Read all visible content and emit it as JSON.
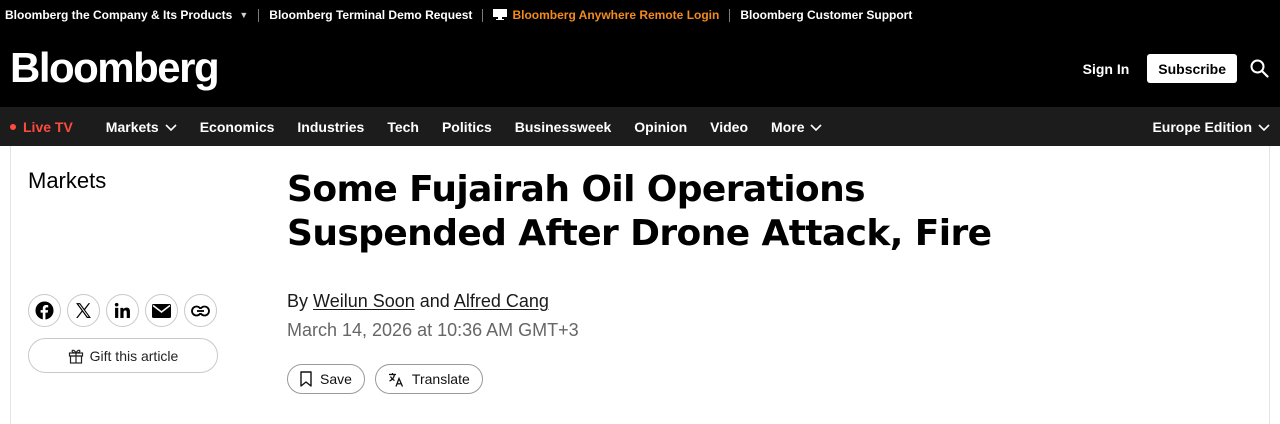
{
  "utility_bar": {
    "items": [
      {
        "label": "Bloomberg the Company & Its Products"
      },
      {
        "label": "Bloomberg Terminal Demo Request"
      },
      {
        "label": "Bloomberg Anywhere Remote Login"
      },
      {
        "label": "Bloomberg Customer Support"
      }
    ],
    "accent_color": "#f48a1e"
  },
  "masthead": {
    "logo": "Bloomberg",
    "sign_in": "Sign In",
    "subscribe": "Subscribe",
    "search_icon": "search-icon"
  },
  "nav": {
    "live_tv": "Live TV",
    "live_color": "#ff4b3e",
    "items": [
      {
        "label": "Markets"
      },
      {
        "label": "Economics"
      },
      {
        "label": "Industries"
      },
      {
        "label": "Tech"
      },
      {
        "label": "Politics"
      },
      {
        "label": "Businessweek"
      },
      {
        "label": "Opinion"
      },
      {
        "label": "Video"
      },
      {
        "label": "More"
      }
    ],
    "edition": "Europe Edition"
  },
  "article": {
    "section": "Markets",
    "headline_line1": "Some Fujairah Oil Operations",
    "headline_line2": "Suspended After Drone Attack, Fire",
    "byline_prefix": "By",
    "author1": "Weilun Soon",
    "byline_and": "and",
    "author2": "Alfred Cang",
    "date": "March 14, 2026 at 10:36 AM GMT+3",
    "share_icons": [
      "facebook-icon",
      "x-icon",
      "linkedin-icon",
      "email-icon",
      "link-icon"
    ],
    "gift_label": "Gift this article",
    "save_label": "Save",
    "translate_label": "Translate"
  }
}
